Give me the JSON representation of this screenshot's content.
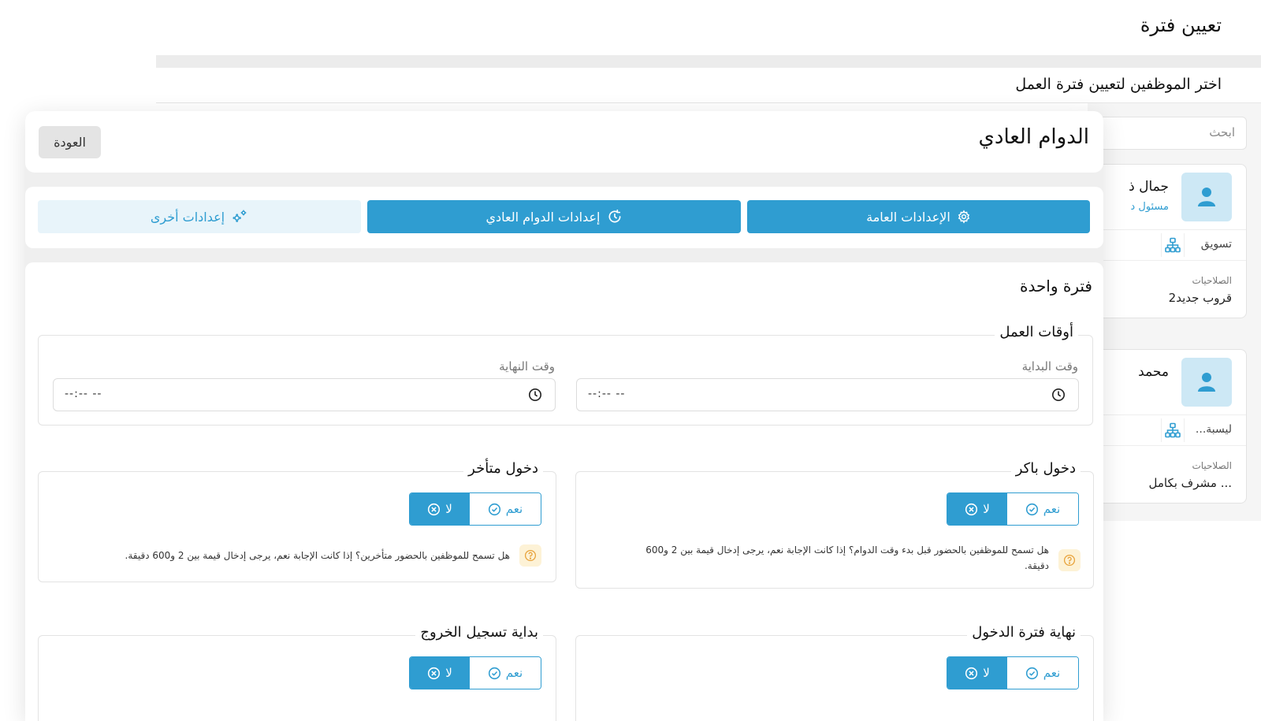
{
  "background": {
    "page_title": "تعيين فترة",
    "subtitle": "اختر الموظفين لتعيين فترة العمل",
    "search_placeholder": "ابحث",
    "employees": [
      {
        "name": "جمال ذ",
        "role": "مسئول د",
        "department": "تسويق",
        "permissions_label": "الصلاحيات",
        "permissions_value": "قروب جديد2"
      },
      {
        "name": "محمد",
        "role": "",
        "department": "...ليسبة",
        "permissions_label": "الصلاحيات",
        "permissions_value": "مشرف بكامل ..."
      }
    ]
  },
  "modal": {
    "title": "الدوام العادي",
    "back_label": "العودة",
    "tabs": [
      {
        "label": "الإعدادات العامة",
        "icon": "gear-icon",
        "active": true
      },
      {
        "label": "إعدادات الدوام العادي",
        "icon": "refresh-clock-icon",
        "active": true
      },
      {
        "label": "إعدادات أخرى",
        "icon": "gears-icon",
        "active": false
      }
    ],
    "section_title": "فترة واحدة",
    "work_hours": {
      "legend": "أوقات العمل",
      "start_label": "وقت البداية",
      "end_label": "وقت النهاية",
      "start_value": "--:-- --",
      "end_value": "--:-- --"
    },
    "toggle_yes": "نعم",
    "toggle_no": "لا",
    "options": {
      "early_entry": {
        "legend": "دخول باكر",
        "hint_line1": "هل تسمح للموظفين بالحضور قبل بدء وقت الدوام؟ إذا كانت الإجابة نعم، يرجى إدخال قيمة بين 2 و600",
        "hint_line2": "دقيقة.",
        "selected": "لا"
      },
      "late_entry": {
        "legend": "دخول متأخر",
        "hint_line1": "هل تسمح للموظفين بالحضور متأخرين؟ إذا كانت الإجابة نعم، يرجى إدخال قيمة بين 2 و600 دقيقة.",
        "selected": "لا"
      },
      "entry_period_end": {
        "legend": "نهاية فترة الدخول",
        "selected": "لا"
      },
      "checkout_start": {
        "legend": "بداية تسجيل الخروج",
        "selected": "لا"
      }
    },
    "colors": {
      "primary": "#2f9dd1",
      "primary_light": "#e8f4fa",
      "hint_bg": "#fdf2d6"
    }
  }
}
